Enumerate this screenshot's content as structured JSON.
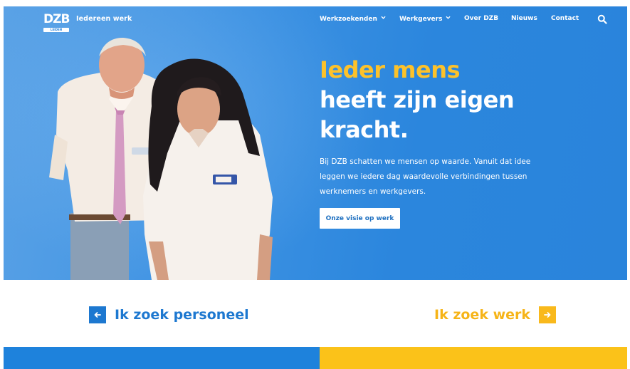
{
  "header": {
    "logo_text": "DZB",
    "logo_sub": "LEIDEN",
    "tagline": "Iedereen werk",
    "nav": [
      {
        "label": "Werkzoekenden",
        "has_dropdown": true
      },
      {
        "label": "Werkgevers",
        "has_dropdown": true
      },
      {
        "label": "Over DZB",
        "has_dropdown": false
      },
      {
        "label": "Nieuws",
        "has_dropdown": false
      },
      {
        "label": "Contact",
        "has_dropdown": false
      }
    ],
    "search_icon": "search-icon"
  },
  "hero": {
    "headline_line1": "Ieder mens",
    "headline_line2": "heeft zijn eigen",
    "headline_line3": "kracht.",
    "intro": "Bij DZB schatten we mensen op waarde. Vanuit dat idee leggen we iedere dag waardevolle verbindingen tussen werknemers en werkgevers.",
    "cta_label": "Onze visie op werk",
    "badge_left": "dzb",
    "badge_right": "dzb"
  },
  "choices": {
    "left_label": "Ik zoek personeel",
    "right_label": "Ik zoek werk"
  },
  "colors": {
    "hero_blue": "#2a84db",
    "accent_yellow": "#fdc22a",
    "brand_blue": "#1d78d0",
    "band_yellow": "#fbc219"
  }
}
